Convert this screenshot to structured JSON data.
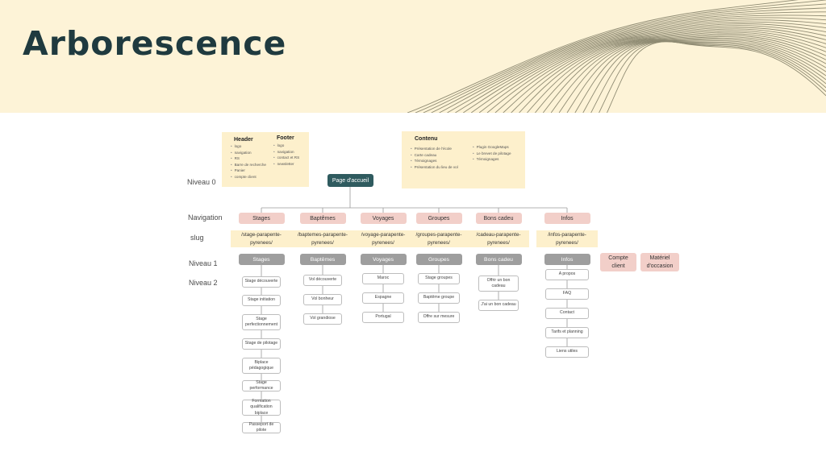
{
  "title": "Arborescence",
  "notes": {
    "header_title": "Header",
    "header_items": [
      "logo",
      "navigation",
      "RS",
      "Barre de recherche",
      "Panier",
      "compte client"
    ],
    "footer_title": "Footer",
    "footer_items": [
      "logo",
      "navigation",
      "contact et RS",
      "newsletter"
    ],
    "contenu_title": "Contenu",
    "contenu_left": [
      "Présentation de l'école",
      "Carte cadeau",
      "Témoignages",
      "Présentation du lieu de vol"
    ],
    "contenu_right": [
      "Plugin GoogleMaps",
      "Le brevet de pilotage",
      "Témoignages"
    ]
  },
  "row_labels": {
    "niveau0": "Niveau 0",
    "navigation": "Navigation",
    "slug": "slug",
    "niveau1": "Niveau 1",
    "niveau2": "Niveau 2"
  },
  "root": "Page d'accueil",
  "columns": [
    {
      "nav": "Stages",
      "slug_line1": "/stage-parapente-",
      "slug_line2": "pyrenees/",
      "level1": "Stages",
      "children": [
        "Stage découverte",
        "Stage initiation",
        "Stage perfectionnement",
        "Stage de pilotage",
        "Biplace pédagogique",
        "Stage performance",
        "Formation qualification biplace",
        "Passeport de pilote"
      ]
    },
    {
      "nav": "Baptêmes",
      "slug_line1": "/baptemes-parapente-",
      "slug_line2": "pyrenees/",
      "level1": "Baptêmes",
      "children": [
        "Vol découverte",
        "Vol bonheur",
        "Vol grandiose"
      ]
    },
    {
      "nav": "Voyages",
      "slug_line1": "/voyage-parapente-",
      "slug_line2": "pyrenees/",
      "level1": "Voyages",
      "children": [
        "Maroc",
        "Espagne",
        "Portugal"
      ]
    },
    {
      "nav": "Groupes",
      "slug_line1": "/groupes-parapente-",
      "slug_line2": "pyrenees/",
      "level1": "Groupes",
      "children": [
        "Stage groupes",
        "Baptême groupe",
        "Offre sur mesure"
      ]
    },
    {
      "nav": "Bons cadeu",
      "slug_line1": "/cadeau-parapente-",
      "slug_line2": "pyrenees/",
      "level1": "Bons cadeu",
      "children": [
        "Offrir un bon cadeau",
        "J'ai un bon cadeau"
      ]
    },
    {
      "nav": "Infos",
      "slug_line1": "/infos-parapente-",
      "slug_line2": "pyrenees/",
      "level1": "Infos",
      "children": [
        "A propos",
        "FAQ",
        "Contact",
        "Tarifs et planning",
        "Liens utiles"
      ]
    }
  ],
  "extras": [
    "Compte client",
    "Matériel d'occasion"
  ],
  "colors": {
    "header_band": "#fdf3d7",
    "title": "#1f3a3f",
    "root_node": "#2f5b5f",
    "nav_pink": "#f2cfc9",
    "level1_gray": "#9e9e9e",
    "note_yellow": "#fdf0cc",
    "topo_lines": "#8f8b73"
  }
}
